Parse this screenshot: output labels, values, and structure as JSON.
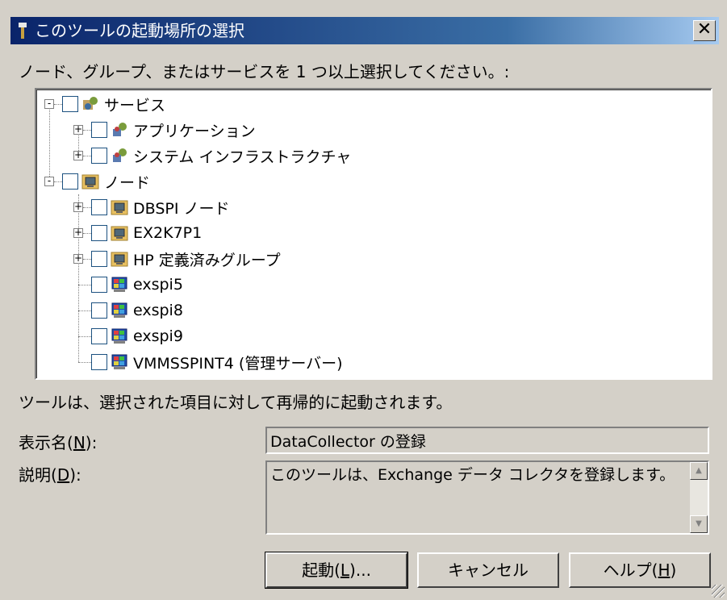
{
  "title": "このツールの起動場所の選択",
  "close_label": "✕",
  "prompt": "ノード、グループ、またはサービスを 1 つ以上選択してください。:",
  "tree": {
    "items": [
      {
        "label": "サービス",
        "level": 0,
        "expand": "-",
        "icon": "services-icon"
      },
      {
        "label": "アプリケーション",
        "level": 1,
        "expand": "+",
        "icon": "application-icon"
      },
      {
        "label": "システム インフラストラクチャ",
        "level": 1,
        "expand": "+",
        "icon": "system-infrastructure-icon"
      },
      {
        "label": "ノード",
        "level": 0,
        "expand": "-",
        "icon": "nodes-folder-icon"
      },
      {
        "label": "DBSPI ノード",
        "level": 1,
        "expand": "+",
        "icon": "node-group-icon"
      },
      {
        "label": "EX2K7P1",
        "level": 1,
        "expand": "+",
        "icon": "node-group-icon"
      },
      {
        "label": "HP 定義済みグループ",
        "level": 1,
        "expand": "+",
        "icon": "node-group-icon"
      },
      {
        "label": "exspi5",
        "level": 1,
        "expand": "",
        "icon": "computer-node-icon"
      },
      {
        "label": "exspi8",
        "level": 1,
        "expand": "",
        "icon": "computer-node-icon"
      },
      {
        "label": "exspi9",
        "level": 1,
        "expand": "",
        "icon": "computer-node-icon"
      },
      {
        "label": "VMMSSPINT4 (管理サーバー)",
        "level": 1,
        "expand": "",
        "icon": "computer-node-icon"
      }
    ]
  },
  "info": "ツールは、選択された項目に対して再帰的に起動されます。",
  "display_name": {
    "label_pre": "表示名(",
    "label_key": "N",
    "label_post": "):",
    "value": "DataCollector の登録"
  },
  "description": {
    "label_pre": "説明(",
    "label_key": "D",
    "label_post": "):",
    "value": "このツールは、Exchange データ コレクタを登録します。"
  },
  "buttons": {
    "launch": {
      "pre": "起動(",
      "key": "L",
      "post": ")..."
    },
    "cancel": "キャンセル",
    "help": {
      "pre": "ヘルプ(",
      "key": "H",
      "post": ")"
    }
  },
  "colors": {
    "titlebar": "#0a246a",
    "face": "#d4d0c8"
  }
}
